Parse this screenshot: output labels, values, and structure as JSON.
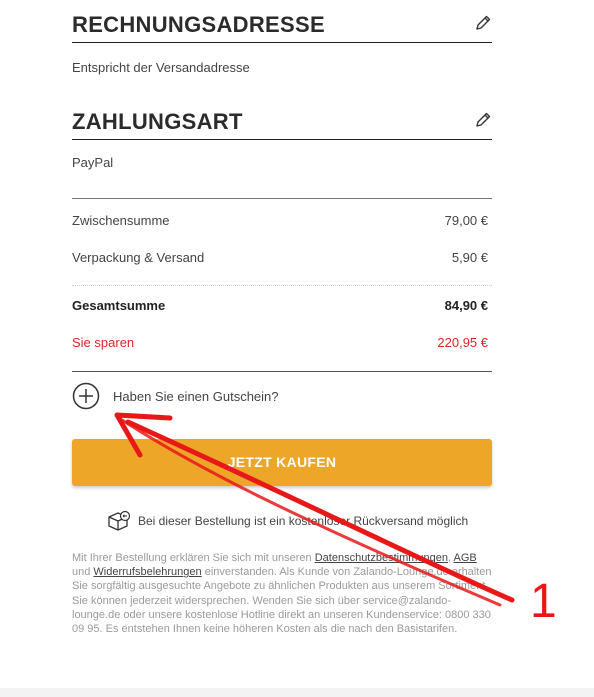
{
  "billing": {
    "title": "RECHNUNGSADRESSE",
    "text": "Entspricht der Versandadresse",
    "edit_icon": "pencil-icon"
  },
  "payment": {
    "title": "ZAHLUNGSART",
    "method": "PayPal",
    "edit_icon": "pencil-icon"
  },
  "summary": {
    "subtotal_label": "Zwischensumme",
    "subtotal_value": "79,00 €",
    "shipping_label": "Verpackung & Versand",
    "shipping_value": "5,90 €",
    "total_label": "Gesamtsumme",
    "total_value": "84,90 €",
    "savings_label": "Sie sparen",
    "savings_value": "220,95 €"
  },
  "coupon": {
    "label": "Haben Sie einen Gutschein?",
    "icon": "plus-circle-icon"
  },
  "buy_button": {
    "label": "JETZT KAUFEN"
  },
  "return_note": {
    "icon": "return-box-icon",
    "text": "Bei dieser Bestellung ist ein kostenloser Rückversand möglich"
  },
  "legal": {
    "part1": "Mit Ihrer Bestellung erklären Sie sich mit unseren ",
    "link_privacy": "Datenschutzbestimmungen",
    "part2": ", ",
    "link_agb": "AGB",
    "part3": " und ",
    "link_revocation": "Widerrufsbelehrungen",
    "part4": " einverstanden. Als Kunde von Zalando-Lounge.de erhalten Sie sorgfältig ausgesuchte Angebote zu ähnlichen Produkten aus unserem Sortiment. Sie können jederzeit widersprechen. Wenden Sie sich über service@zalando-lounge.de oder unsere kostenlose Hotline direkt an unseren Kundenservice: 0800 330 09 95. Es entstehen Ihnen keine höheren Kosten als die nach den Basistarifen."
  },
  "annotation": {
    "number": "1",
    "color": "#e81818"
  },
  "colors": {
    "button": "#eda628",
    "savings": "#e02424"
  }
}
